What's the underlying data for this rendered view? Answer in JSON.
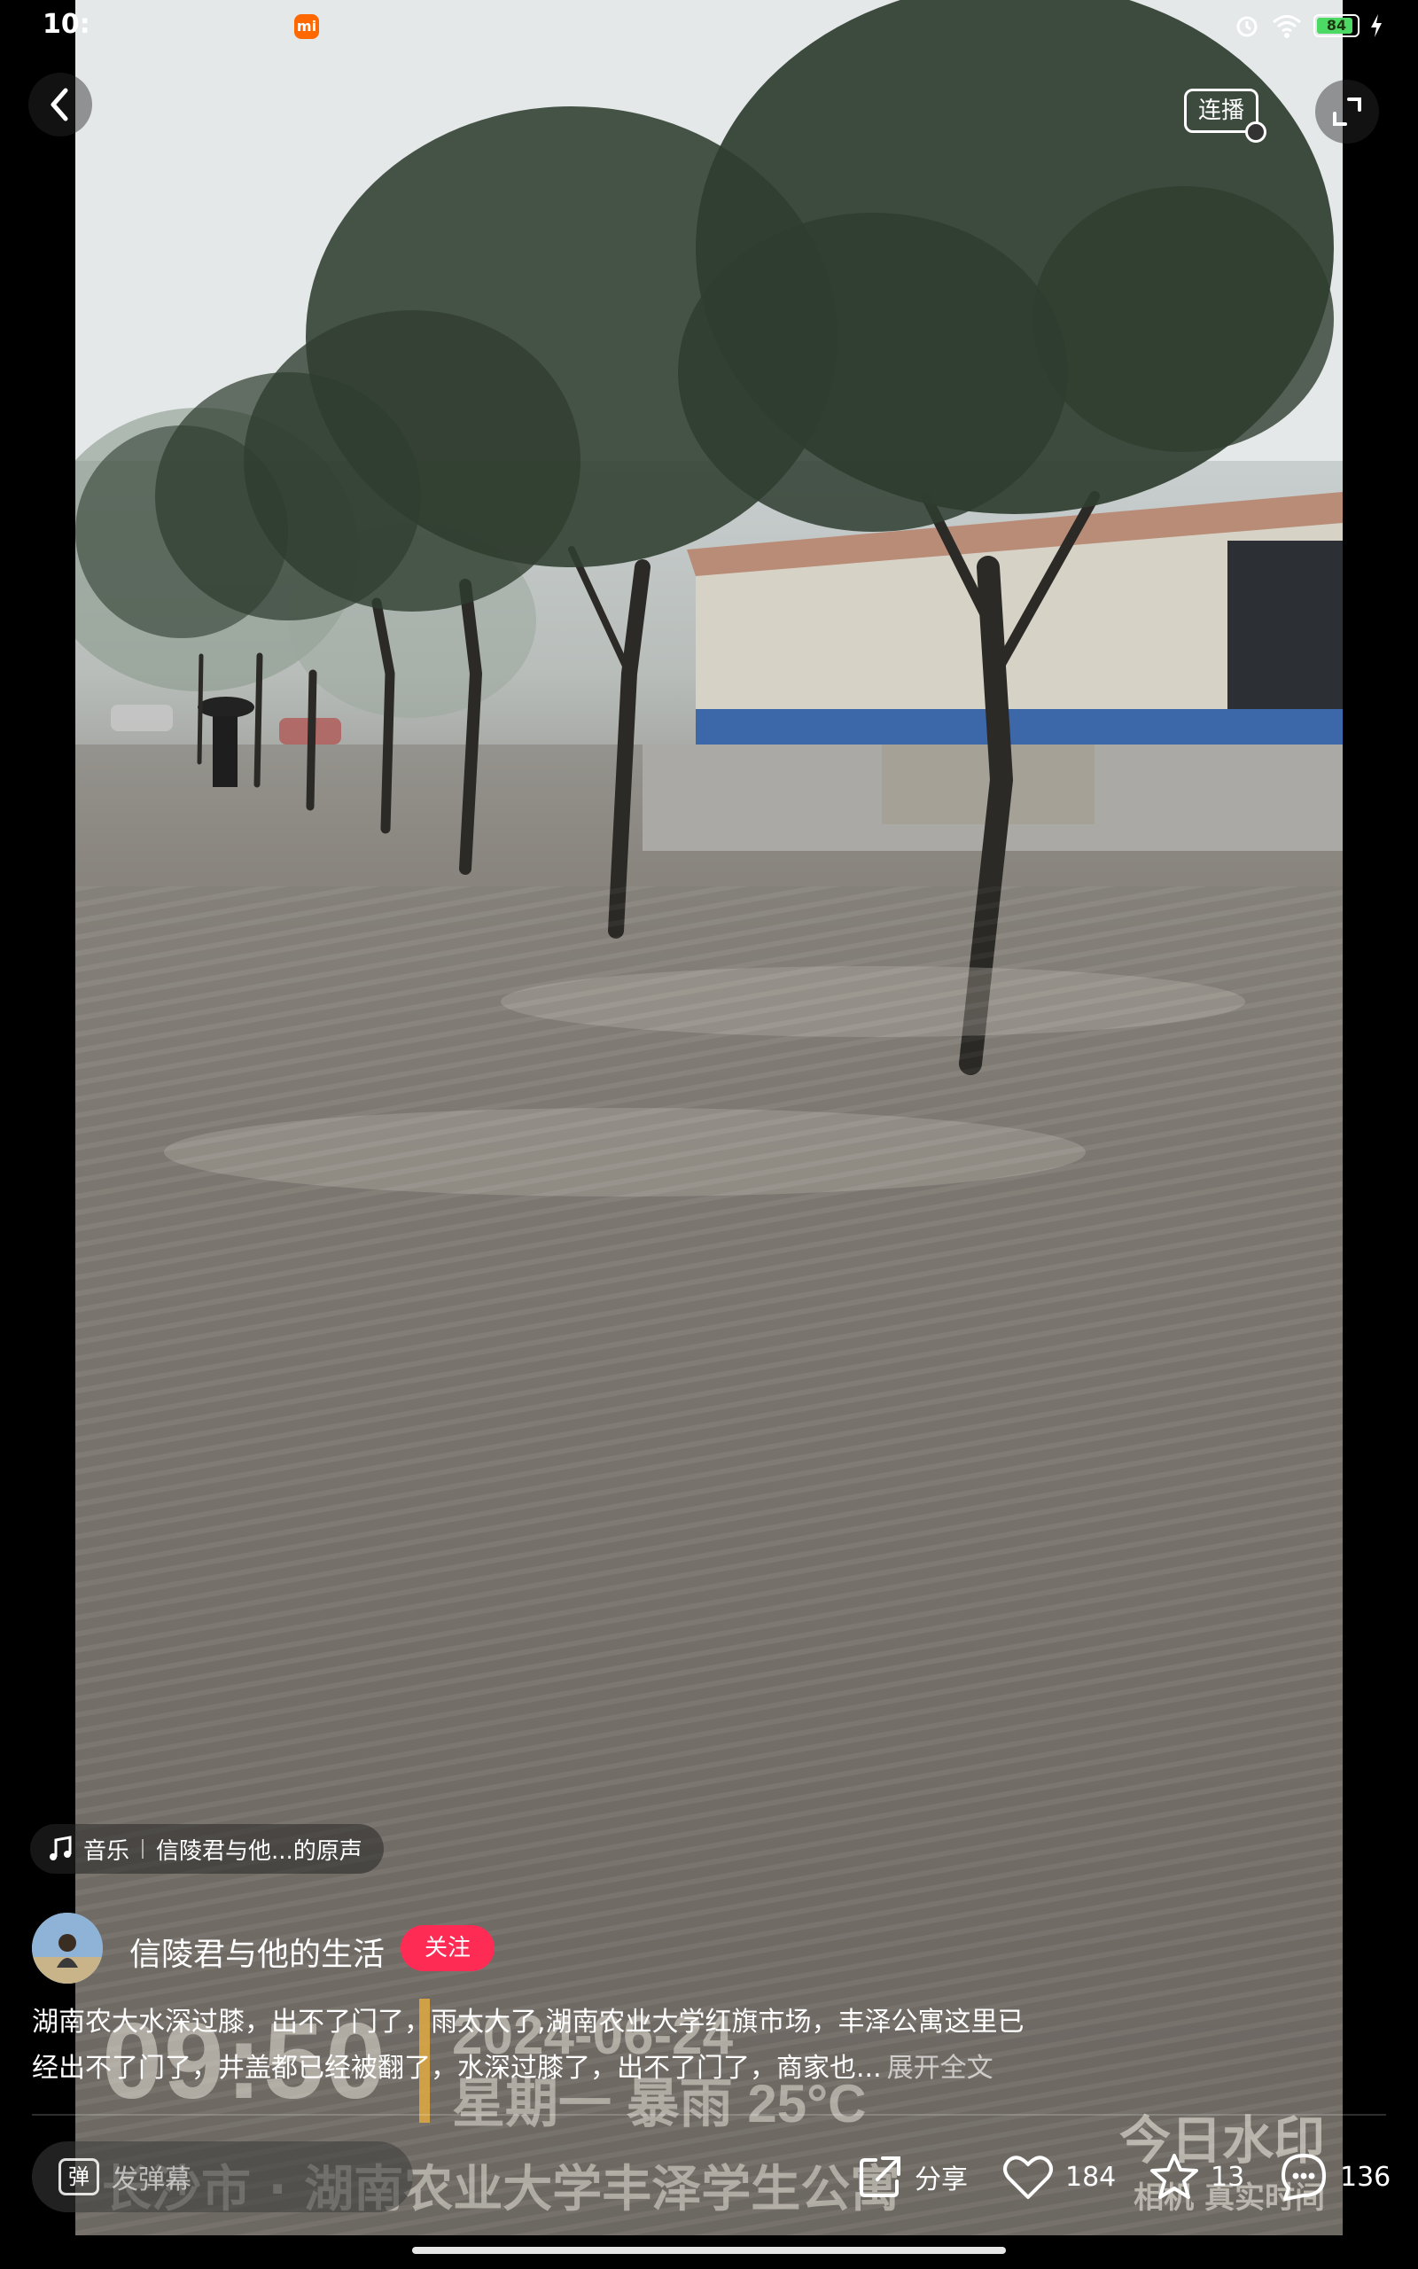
{
  "status_bar": {
    "time": "10:",
    "battery": "84"
  },
  "top": {
    "continuous_label": "连播"
  },
  "video_overlay": {
    "time": "09:50",
    "date": "2024-06-24",
    "weather": "星期一 暴雨 25°C",
    "place": "长沙市 · 湖南农业大学丰泽学生公寓",
    "stamp_top": "今日水印",
    "stamp_bottom": "相机 真实时间"
  },
  "music": {
    "prefix": "音乐",
    "title": "信陵君与他...的原声"
  },
  "author": {
    "name": "信陵君与他的生活",
    "follow_label": "关注"
  },
  "caption": {
    "line1": "湖南农大水深过膝，出不了门了，雨太大了,湖南农业大学红旗市场，丰泽公寓这里已",
    "line2": "经出不了门了，井盖都已经被翻了，水深过膝了，出不了门了，商家也...",
    "expand": "展开全文"
  },
  "bottom_bar": {
    "danmaku_icon_text": "弹",
    "danmaku_placeholder": "发弹幕",
    "share_label": "分享",
    "like_count": "184",
    "favorite_count": "13",
    "comment_count": "136"
  },
  "colors": {
    "follow": "#fe2c55",
    "battery": "#4cd964",
    "mi": "#ff6700"
  }
}
